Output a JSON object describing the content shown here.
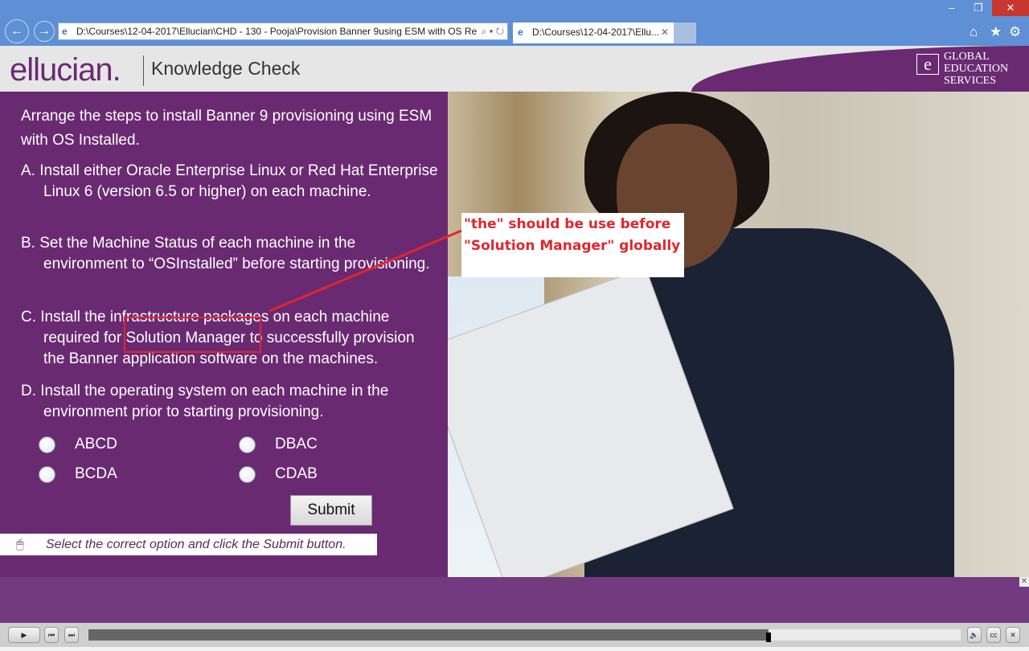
{
  "browser": {
    "address": "D:\\Courses\\12-04-2017\\Ellucian\\CHD - 130 - Pooja\\Provision Banner 9using ESM with OS Re",
    "tab_title": "D:\\Courses\\12-04-2017\\Ellu...",
    "icons": [
      "back-icon",
      "forward-icon",
      "search-icon",
      "refresh-icon",
      "home-icon",
      "star-icon",
      "gear-icon"
    ]
  },
  "header": {
    "logo": "ellucian.",
    "title": "Knowledge Check",
    "brand_badge": "GLOBAL EDUCATION SERVICES"
  },
  "question": "Arrange the steps to install Banner 9 provisioning using ESM with OS Installed.",
  "steps": [
    "A.  Install either Oracle Enterprise Linux or Red Hat Enterprise Linux 6 (version 6.5 or higher) on each machine.",
    "B.  Set the Machine Status of each machine in the environment to “OSInstalled” before starting provisioning.",
    "C.  Install the infrastructure packages on each machine required for Solution Manager to successfully provision the Banner application software on the machines.",
    "D.  Install the operating system on each machine in the environment prior to starting provisioning."
  ],
  "options": [
    "ABCD",
    "DBAC",
    "BCDA",
    "CDAB"
  ],
  "submit_label": "Submit",
  "hint": "Select the correct option and click the Submit button.",
  "annotation": "\"the\" should be use before \"Solution Manager\" globally",
  "player": {
    "progress": 0.78,
    "buttons": [
      "play",
      "prev",
      "next",
      "volume",
      "cc",
      "close"
    ]
  },
  "colors": {
    "purple": "#6a2a72",
    "annotation_red": "#e0262e"
  }
}
